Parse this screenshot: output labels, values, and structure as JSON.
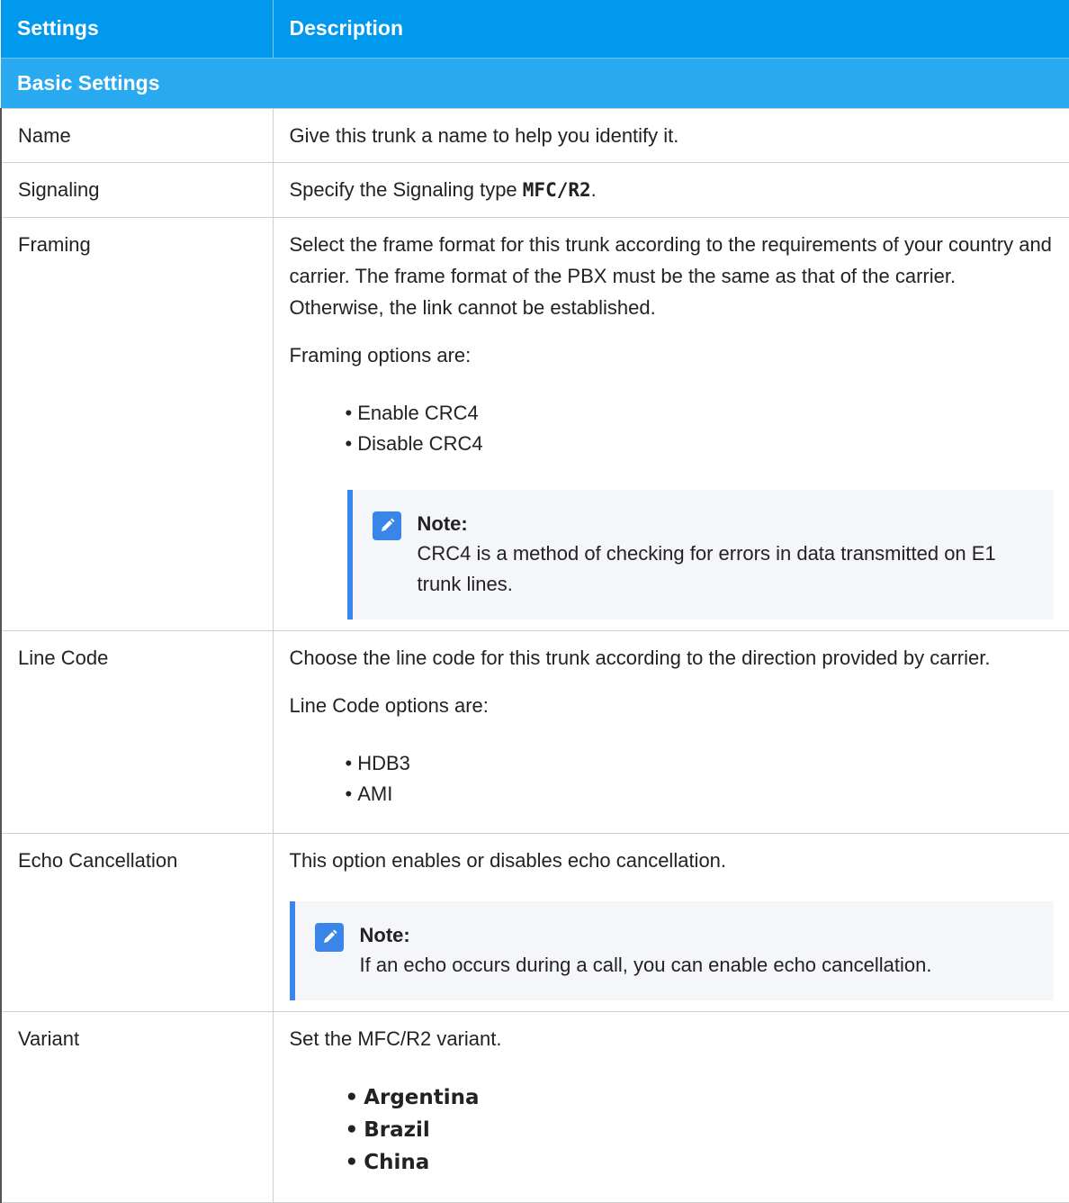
{
  "columns": {
    "settings": "Settings",
    "description": "Description"
  },
  "group": "Basic Settings",
  "rows": {
    "name": {
      "label": "Name",
      "desc": "Give this trunk a name to help you identify it."
    },
    "signaling": {
      "label": "Signaling",
      "desc_pre": "Specify the Signaling type ",
      "desc_code": "MFC/R2",
      "desc_post": "."
    },
    "framing": {
      "label": "Framing",
      "desc": "Select the frame format for this trunk according to the requirements of your country and carrier. The frame format of the PBX must be the same as that of the carrier. Otherwise, the link cannot be established.",
      "options_intro": "Framing options are:",
      "options": [
        "Enable CRC4",
        "Disable CRC4"
      ],
      "note_title": "Note:",
      "note_text": "CRC4 is a method of checking for errors in data transmitted on E1 trunk lines."
    },
    "line_code": {
      "label": "Line Code",
      "desc": "Choose the line code for this trunk according to the direction provided by carrier.",
      "options_intro": "Line Code options are:",
      "options": [
        "HDB3",
        "AMI"
      ]
    },
    "echo": {
      "label": "Echo Cancellation",
      "desc": "This option enables or disables echo cancellation.",
      "note_title": "Note:",
      "note_text": "If an echo occurs during a call, you can enable echo cancellation."
    },
    "variant": {
      "label": "Variant",
      "desc": "Set the MFC/R2 variant.",
      "options": [
        "Argentina",
        "Brazil",
        "China"
      ]
    }
  },
  "icons": {
    "note": "pencil-note-icon"
  },
  "colors": {
    "header": "#0099ee",
    "group": "#29a9f0",
    "note_accent": "#3a86e8",
    "note_bg": "#f4f6f9"
  }
}
